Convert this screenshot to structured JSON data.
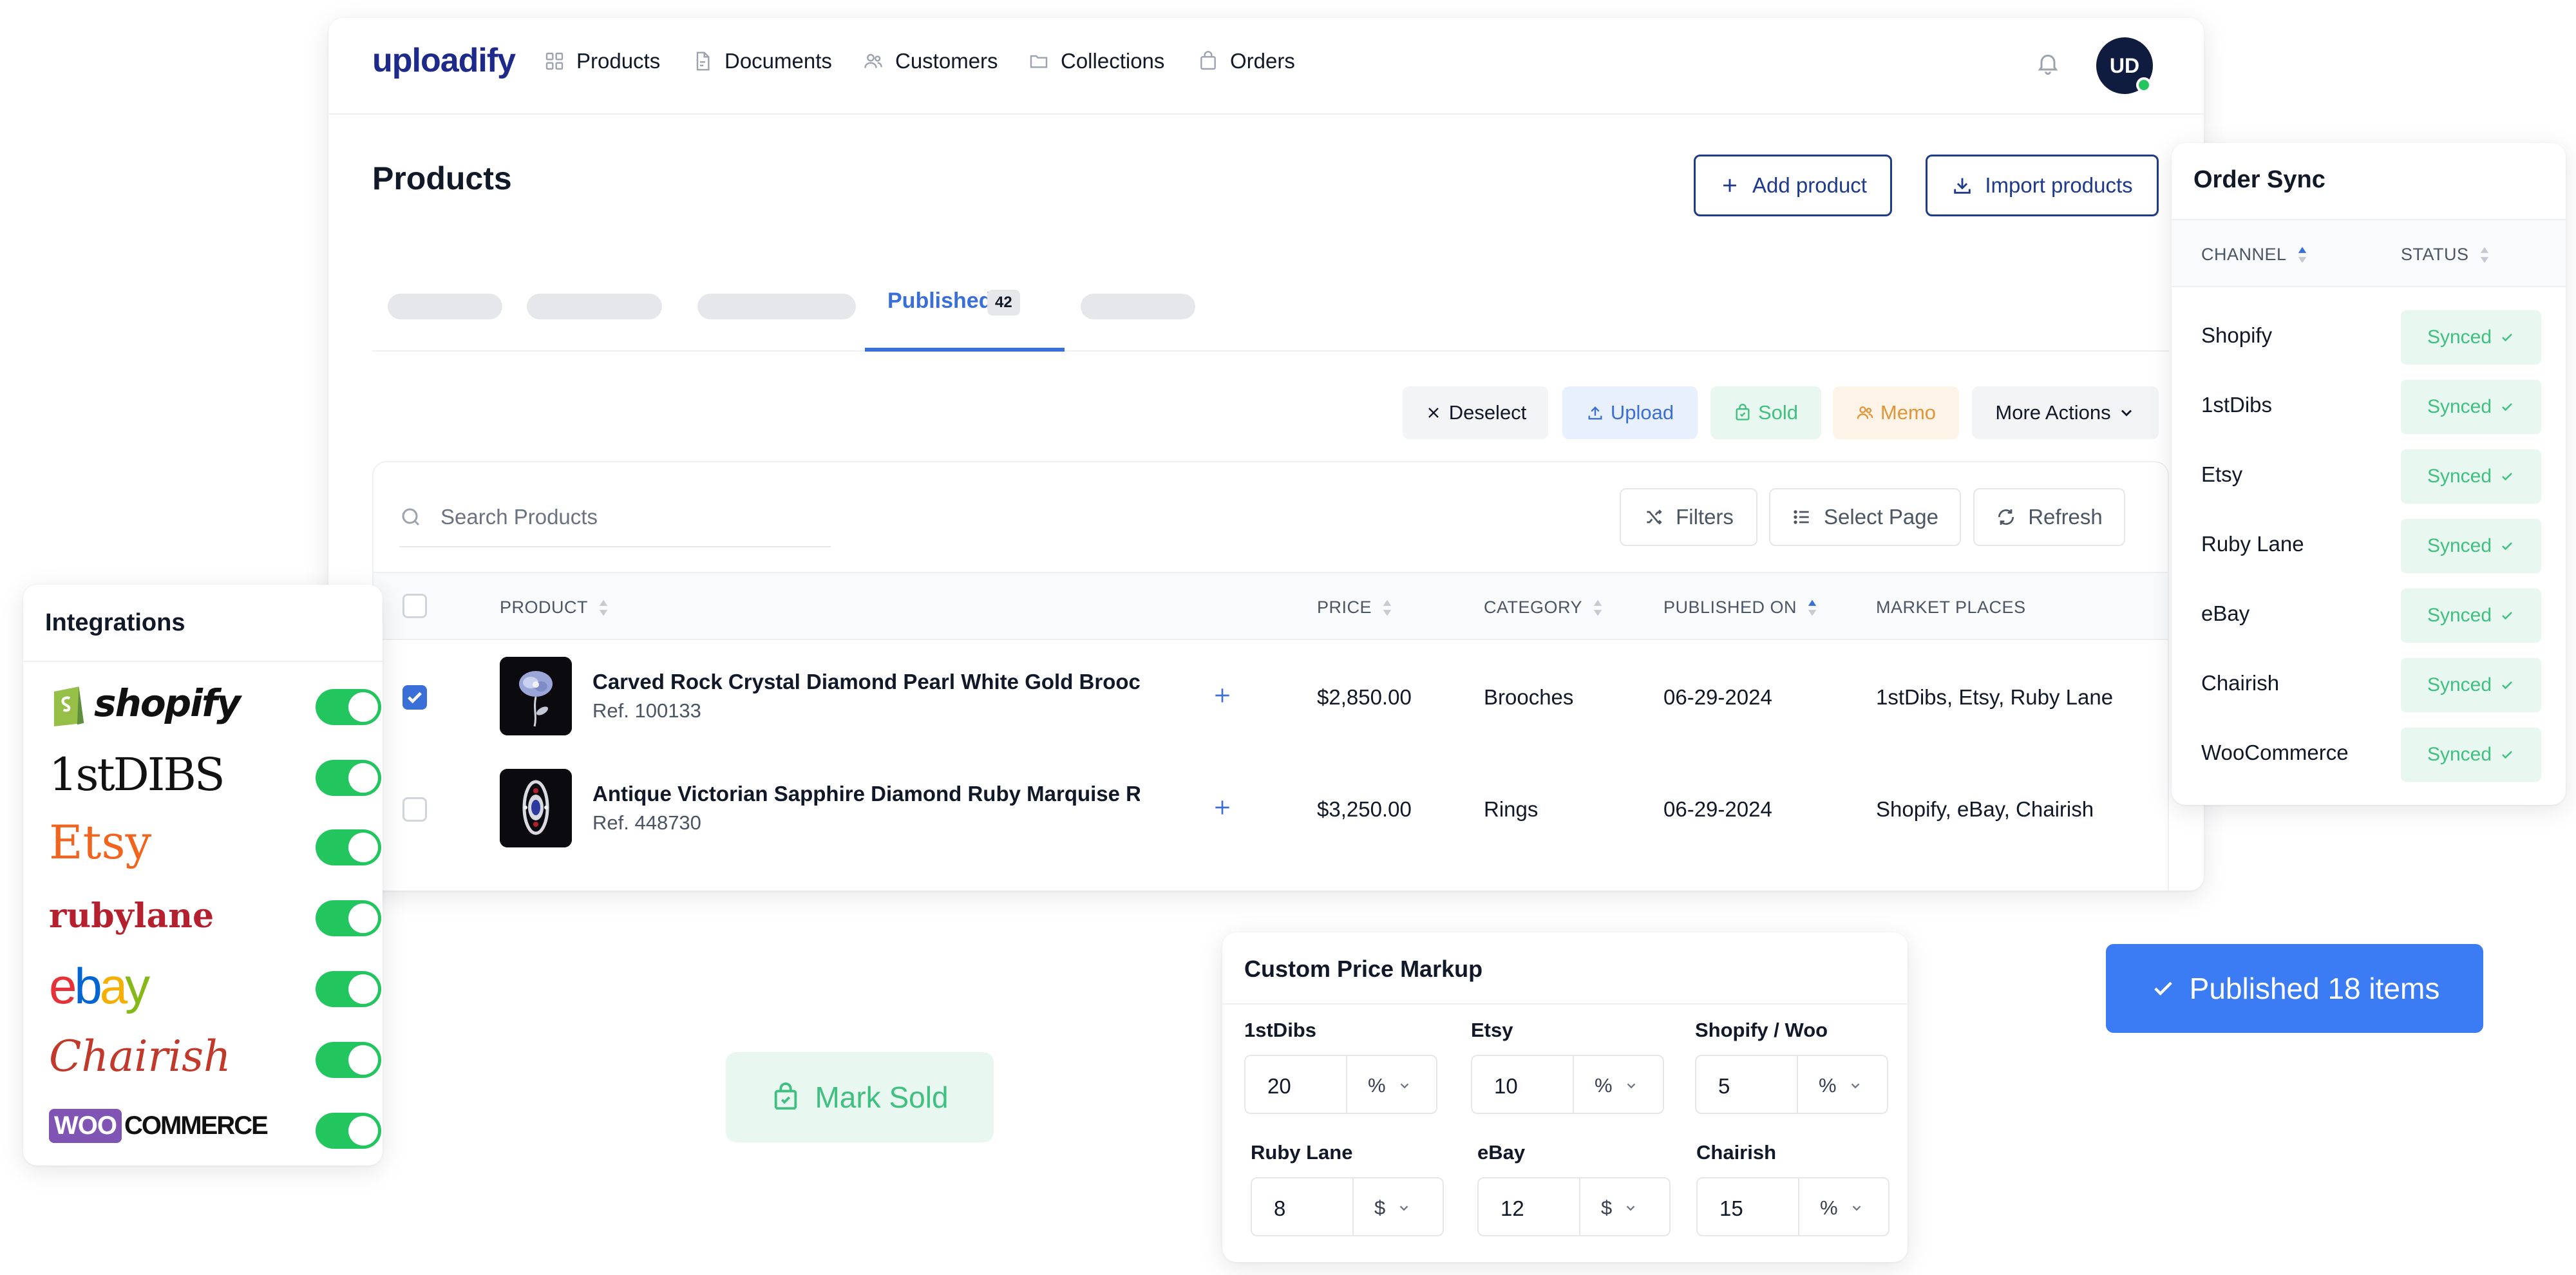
{
  "app": {
    "logo": "uploadify",
    "avatar_initials": "UD"
  },
  "nav": [
    {
      "label": "Products",
      "icon": "grid-icon"
    },
    {
      "label": "Documents",
      "icon": "document-icon"
    },
    {
      "label": "Customers",
      "icon": "users-icon"
    },
    {
      "label": "Collections",
      "icon": "folder-icon"
    },
    {
      "label": "Orders",
      "icon": "bag-icon"
    }
  ],
  "page": {
    "title": "Products",
    "add_label": "Add product",
    "import_label": "Import products"
  },
  "tabs": {
    "active_label": "Published",
    "active_count": "42"
  },
  "actions": {
    "deselect": "Deselect",
    "upload": "Upload",
    "sold": "Sold",
    "memo": "Memo",
    "more": "More Actions"
  },
  "toolbar": {
    "search_placeholder": "Search Products",
    "filters": "Filters",
    "select_page": "Select Page",
    "refresh": "Refresh"
  },
  "table": {
    "headers": {
      "product": "PRODUCT",
      "price": "PRICE",
      "category": "CATEGORY",
      "published_on": "PUBLISHED ON",
      "market_places": "MARKET PLACES"
    },
    "rows": [
      {
        "checked": true,
        "name": "Carved Rock Crystal Diamond Pearl White Gold Brooch",
        "ref": "Ref. 100133",
        "price": "$2,850.00",
        "category": "Brooches",
        "published_on": "06-29-2024",
        "market_places": "1stDibs, Etsy, Ruby Lane"
      },
      {
        "checked": false,
        "name": "Antique Victorian Sapphire Diamond Ruby Marquise Ring",
        "ref": "Ref. 448730",
        "price": "$3,250.00",
        "category": "Rings",
        "published_on": "06-29-2024",
        "market_places": "Shopify, eBay, Chairish"
      }
    ]
  },
  "order_sync": {
    "title": "Order Sync",
    "col_channel": "CHANNEL",
    "col_status": "STATUS",
    "rows": [
      {
        "channel": "Shopify",
        "status": "Synced"
      },
      {
        "channel": "1stDibs",
        "status": "Synced"
      },
      {
        "channel": "Etsy",
        "status": "Synced"
      },
      {
        "channel": "Ruby Lane",
        "status": "Synced"
      },
      {
        "channel": "eBay",
        "status": "Synced"
      },
      {
        "channel": "Chairish",
        "status": "Synced"
      },
      {
        "channel": "WooCommerce",
        "status": "Synced"
      }
    ]
  },
  "integrations": {
    "title": "Integrations",
    "items": [
      {
        "logo": "shopify",
        "enabled": true
      },
      {
        "logo": "1stDIBS",
        "enabled": true
      },
      {
        "logo": "Etsy",
        "enabled": true
      },
      {
        "logo": "rubylane",
        "enabled": true
      },
      {
        "logo": "ebay",
        "enabled": true
      },
      {
        "logo": "Chairish",
        "enabled": true
      },
      {
        "logo_a": "WOO",
        "logo_b": "COMMERCE",
        "enabled": true
      }
    ]
  },
  "mark_sold": {
    "label": "Mark Sold"
  },
  "markup": {
    "title": "Custom Price Markup",
    "fields": [
      {
        "label": "1stDibs",
        "value": "20",
        "unit": "%"
      },
      {
        "label": "Etsy",
        "value": "10",
        "unit": "%"
      },
      {
        "label": "Shopify / Woo",
        "value": "5",
        "unit": "%"
      },
      {
        "label": "Ruby Lane",
        "value": "8",
        "unit": "$"
      },
      {
        "label": "eBay",
        "value": "12",
        "unit": "$"
      },
      {
        "label": "Chairish",
        "value": "15",
        "unit": "%"
      }
    ]
  },
  "toast": {
    "label": "Published 18 items"
  },
  "colors": {
    "accent": "#3b6fd8",
    "brand_navy": "#1e2a8a",
    "success": "#3fbf80",
    "success_bg": "#e8f8f0",
    "toggle_on": "#22c55e",
    "memo": "#e0953a",
    "toast_bg": "#3b7cf4"
  }
}
